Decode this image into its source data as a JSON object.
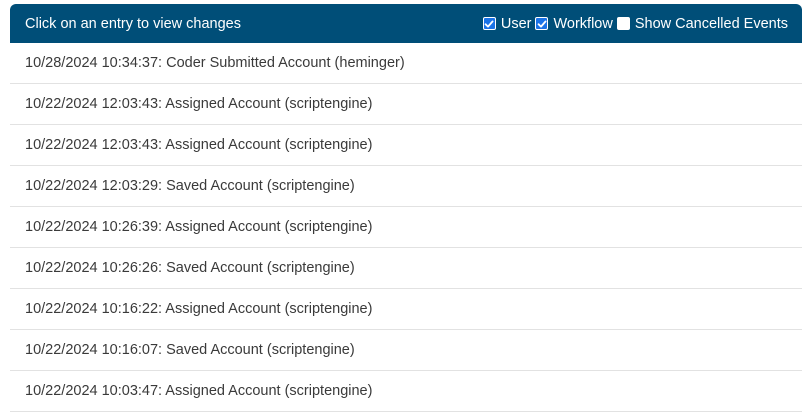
{
  "header": {
    "title": "Click on an entry to view changes",
    "filters": [
      {
        "label": "User",
        "checked": true
      },
      {
        "label": "Workflow",
        "checked": true
      },
      {
        "label": "Show Cancelled Events",
        "checked": false
      }
    ]
  },
  "entries": [
    "10/28/2024 10:34:37: Coder Submitted Account (heminger)",
    "10/22/2024 12:03:43: Assigned Account (scriptengine)",
    "10/22/2024 12:03:43: Assigned Account (scriptengine)",
    "10/22/2024 12:03:29: Saved Account (scriptengine)",
    "10/22/2024 10:26:39: Assigned Account (scriptengine)",
    "10/22/2024 10:26:26: Saved Account (scriptengine)",
    "10/22/2024 10:16:22: Assigned Account (scriptengine)",
    "10/22/2024 10:16:07: Saved Account (scriptengine)",
    "10/22/2024 10:03:47: Assigned Account (scriptengine)"
  ],
  "colors": {
    "header_bg": "#004e78",
    "checkbox_checked": "#1a73e8",
    "row_divider": "#e2e2e2"
  }
}
